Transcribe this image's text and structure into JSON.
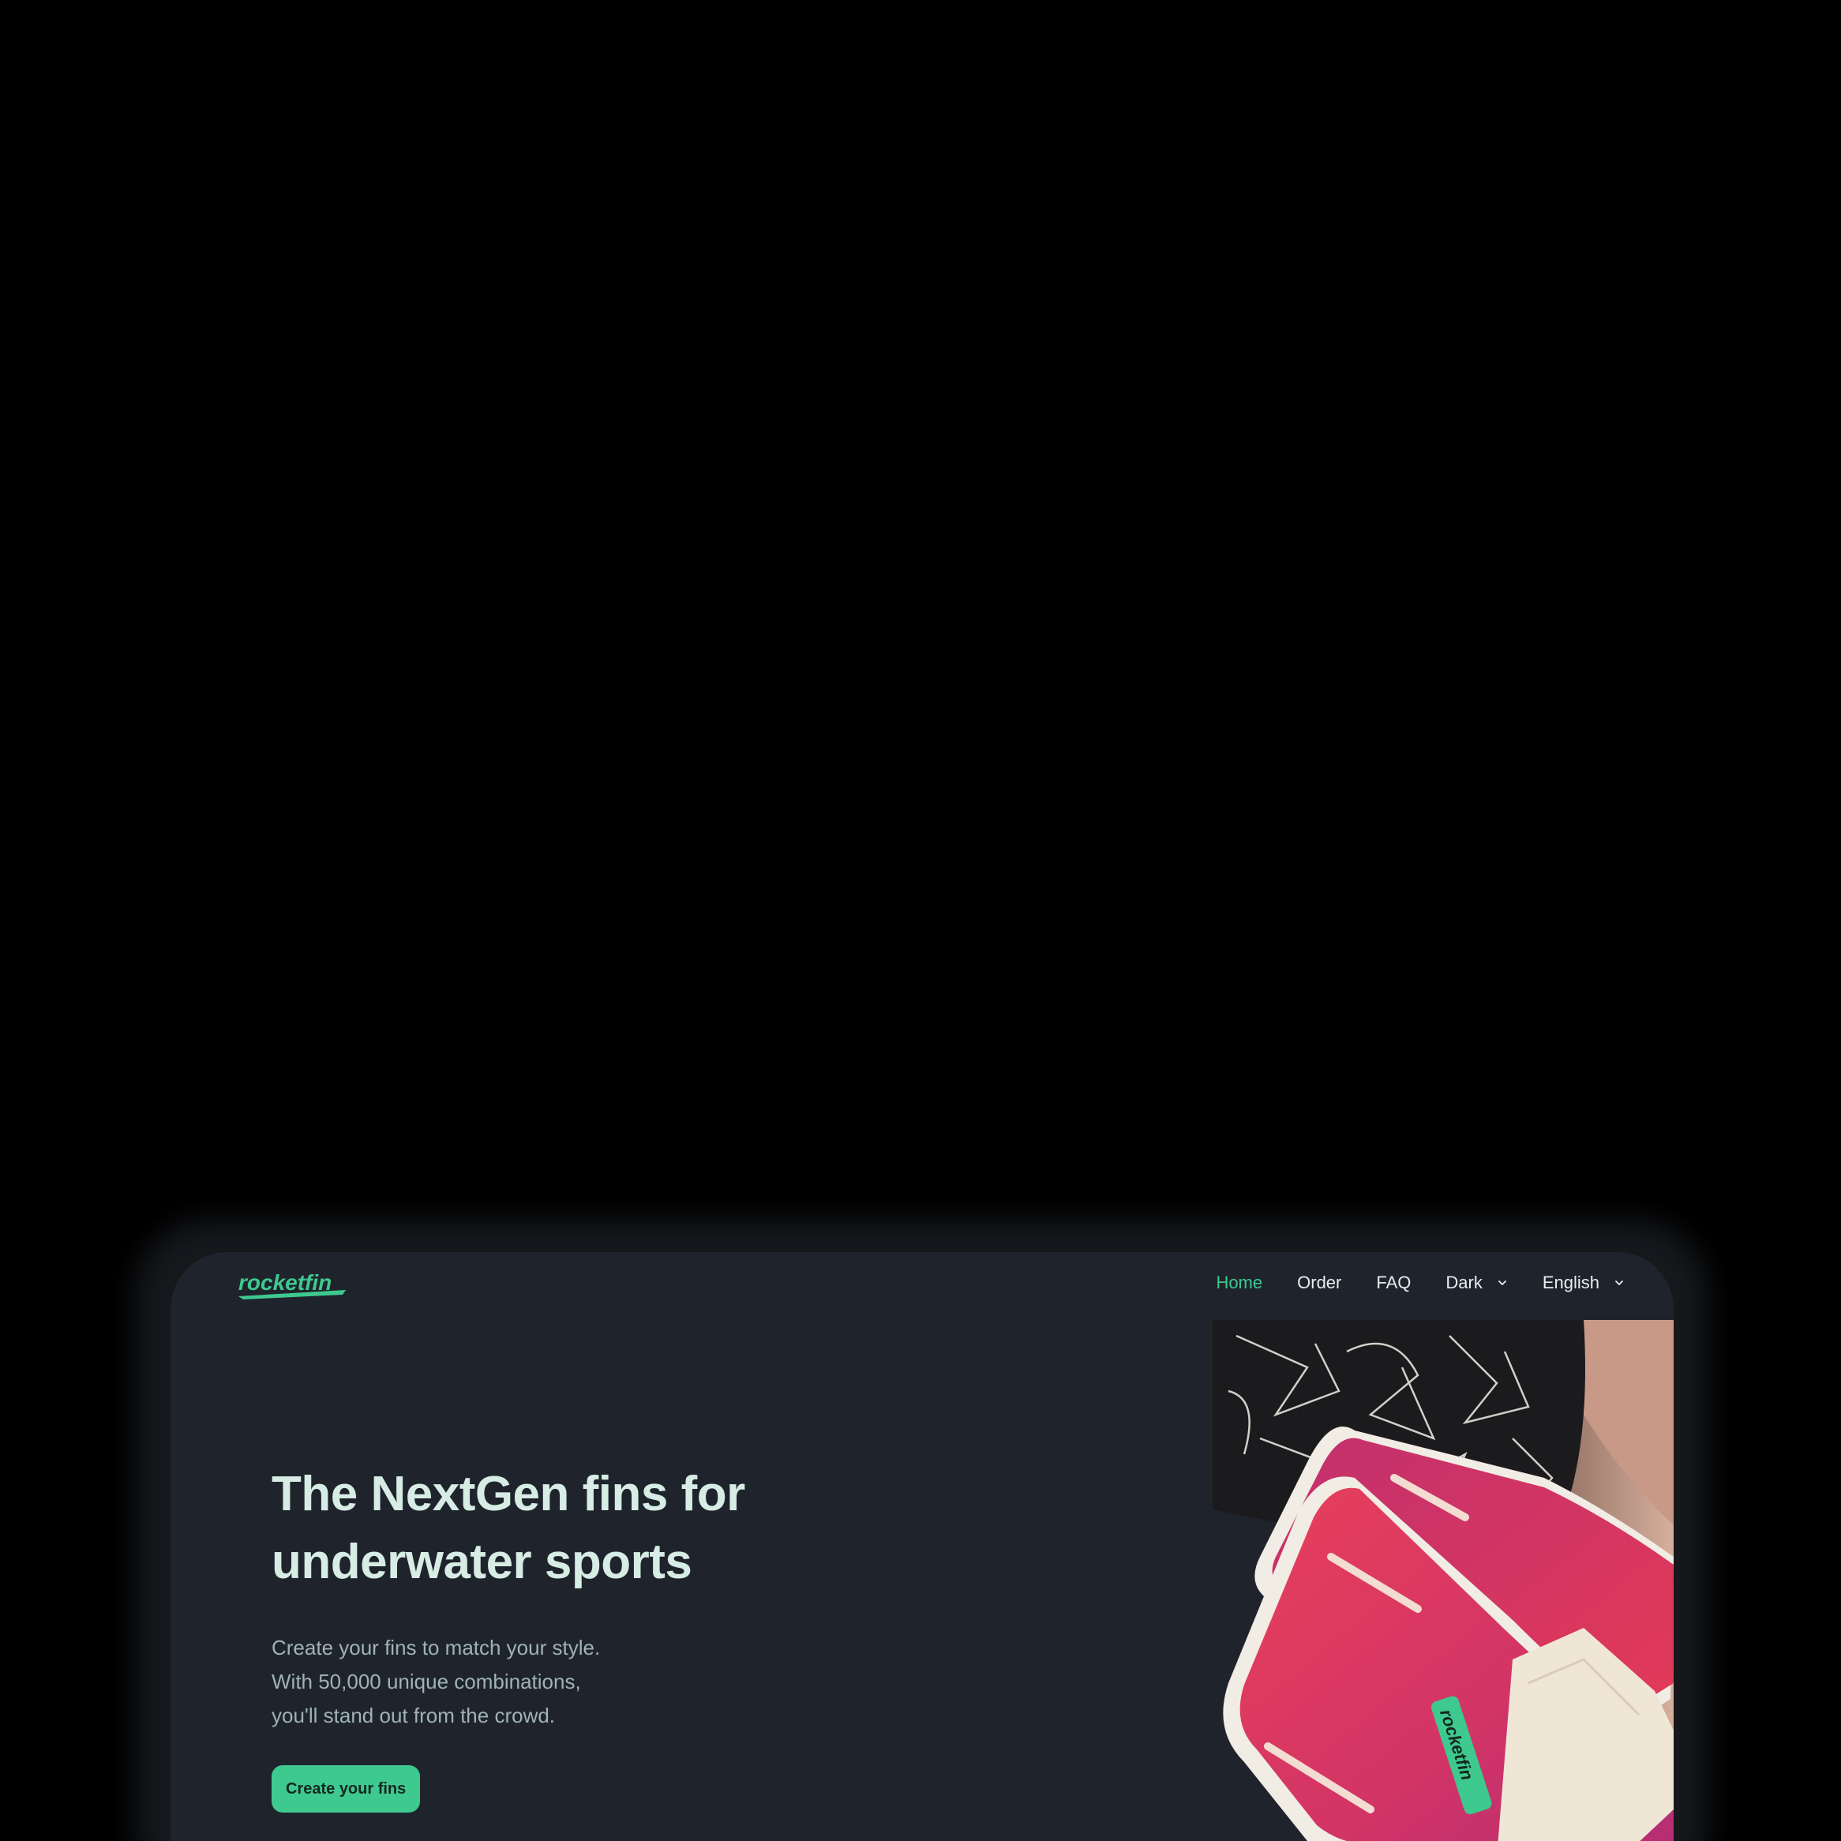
{
  "brand": {
    "name": "rocketfin",
    "accent": "#3ec98f",
    "background": "#1f242c"
  },
  "nav": {
    "home": "Home",
    "order": "Order",
    "faq": "FAQ",
    "theme": "Dark",
    "language": "English"
  },
  "hero": {
    "title_line1": "The NextGen fins for",
    "title_line2": "underwater sports",
    "subtitle_line1": "Create your fins to match your style.",
    "subtitle_line2": "With 50,000 unique combinations,",
    "subtitle_line3": "you'll stand out from the crowd.",
    "cta_label": "Create your fins"
  },
  "icons": {
    "theme_dropdown": "chevron-down-icon",
    "language_dropdown": "chevron-down-icon"
  }
}
